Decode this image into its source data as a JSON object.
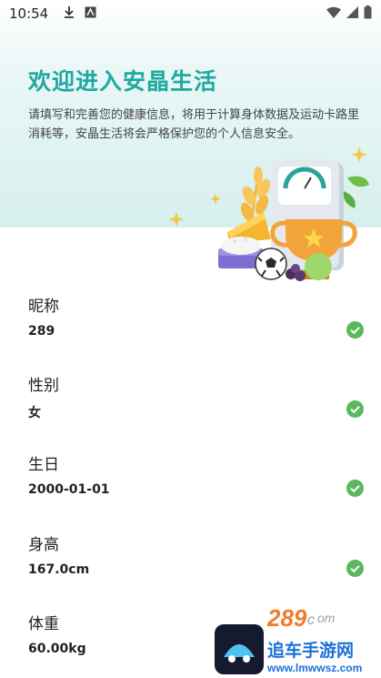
{
  "status_bar": {
    "time": "10:54"
  },
  "header": {
    "title": "欢迎进入安晶生活",
    "description": "请填写和完善您的健康信息，将用于计算身体数据及运动卡路里消耗等，安晶生活将会严格保护您的个人信息安全。"
  },
  "fields": [
    {
      "label": "昵称",
      "value": "289"
    },
    {
      "label": "性别",
      "value": "女"
    },
    {
      "label": "生日",
      "value": "2000-01-01"
    },
    {
      "label": "身高",
      "value": "167.0cm"
    },
    {
      "label": "体重",
      "value": "60.00kg"
    }
  ],
  "watermark": {
    "brand": "289",
    "text": "追车手游网",
    "url": "www.lmwwsz.com"
  },
  "colors": {
    "accent": "#1fa9a1",
    "check": "#5cb85c"
  }
}
